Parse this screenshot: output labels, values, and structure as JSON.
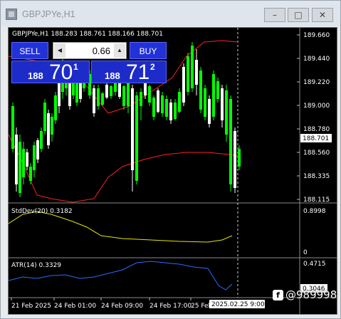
{
  "window": {
    "title": "GBPJPYe,H1",
    "min_glyph": "–",
    "max_glyph": "□",
    "close_glyph": "✕"
  },
  "chart": {
    "caption": "GBPJPYe,H1  188.283 188.761 188.166 188.701",
    "colors": {
      "background": "#000000",
      "bull_candle": "#00ff00",
      "bear_candle": "#ffffff",
      "band_upper": "#ff2020",
      "band_lower": "#ff2020",
      "stddev_line": "#e6e600",
      "atr_line": "#2a6cff",
      "grid": "#3a3a3a"
    },
    "price_ticks": [
      "189.660",
      "189.440",
      "189.220",
      "189.000",
      "188.780",
      "188.560",
      "188.335",
      "188.115"
    ],
    "current_price": "188.701",
    "time_ticks": [
      "21 Feb 2025",
      "24 Feb 01:00",
      "24 Feb 09:00",
      "24 Feb 17:00",
      "25 Feb"
    ],
    "crosshair_time": "2025.02.25 9:00"
  },
  "trade_panel": {
    "sell_label": "SELL",
    "buy_label": "BUY",
    "volume": "0.66",
    "arrow_left": "◀",
    "arrow_right": "▲",
    "sell_price_prefix": "188",
    "sell_price_big": "70",
    "sell_price_sup": "1",
    "buy_price_prefix": "188",
    "buy_price_big": "71",
    "buy_price_sup": "2"
  },
  "indicators": {
    "stddev_label": "StdDev(20) 0.3182",
    "stddev_max": "0.8998",
    "stddev_min": "0",
    "atr_label": "ATR(14) 0.3329",
    "atr_max": "0.4715",
    "atr_current": "0.3046"
  },
  "watermark": {
    "icon_glyph": "f",
    "text": "@989998"
  }
}
